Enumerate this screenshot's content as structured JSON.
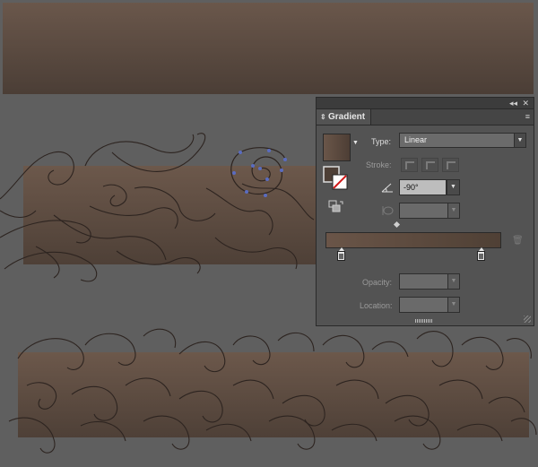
{
  "panel": {
    "tab_title": "Gradient",
    "tab_arrows_glyph": "⇕",
    "collapse_glyph": "◂◂",
    "close_glyph": "✕",
    "menu_glyph": "≡",
    "type_label": "Type:",
    "type_value": "Linear",
    "stroke_label": "Stroke:",
    "angle_value": "-90°",
    "opacity_label": "Opacity:",
    "location_label": "Location:",
    "dropdown_glyph": "▼",
    "trash_glyph": "🗑",
    "gradient": {
      "start_color": "#6a5548",
      "end_color": "#4f4035"
    }
  },
  "icons": {
    "angle": "angle-icon",
    "aspect": "aspect-ratio-icon",
    "reverse": "reverse-gradient-icon",
    "fill_stroke": "fill-stroke-swatch-icon",
    "delete": "delete-stop-icon"
  },
  "colors": {
    "canvas": "#5f5f5f",
    "panel": "#535353",
    "wood_light": "#6e5a4d",
    "wood_dark": "#4b3e35",
    "path_stroke": "#2d2420",
    "selection": "#5a6cc0"
  }
}
